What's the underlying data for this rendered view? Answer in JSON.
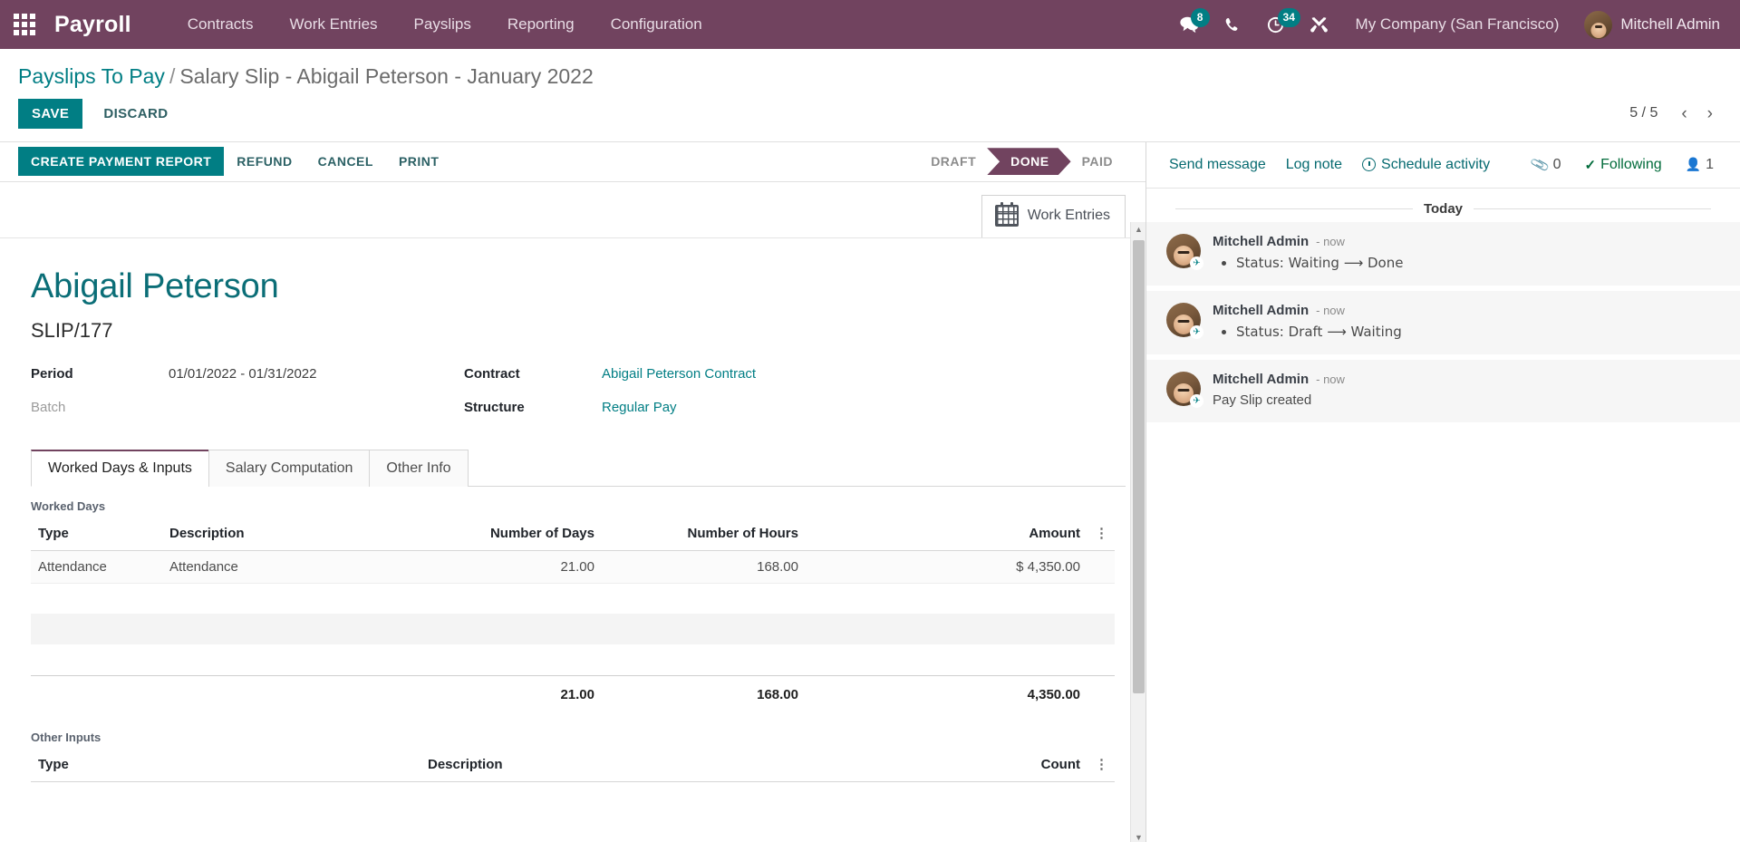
{
  "navbar": {
    "apps_icon": "apps-grid-icon",
    "brand": "Payroll",
    "menus": [
      "Contracts",
      "Work Entries",
      "Payslips",
      "Reporting",
      "Configuration"
    ],
    "messages_badge": "8",
    "activities_badge": "34",
    "company": "My Company (San Francisco)",
    "user": "Mitchell Admin",
    "icons": [
      "messages-icon",
      "phone-icon",
      "activities-icon",
      "debug-tools-icon"
    ]
  },
  "control_panel": {
    "breadcrumb_root": "Payslips To Pay",
    "breadcrumb_sep": "/",
    "breadcrumb_current": "Salary Slip - Abigail Peterson - January 2022",
    "save_label": "SAVE",
    "discard_label": "DISCARD",
    "pager_count": "5 / 5",
    "prev_glyph": "‹",
    "next_glyph": "›"
  },
  "statusbar": {
    "buttons": [
      {
        "label": "CREATE PAYMENT REPORT",
        "primary": true
      },
      {
        "label": "REFUND",
        "primary": false
      },
      {
        "label": "CANCEL",
        "primary": false
      },
      {
        "label": "PRINT",
        "primary": false
      }
    ],
    "stages": [
      {
        "label": "DRAFT",
        "active": false
      },
      {
        "label": "DONE",
        "active": true
      },
      {
        "label": "PAID",
        "active": false
      }
    ]
  },
  "form": {
    "stat_button": {
      "label": "Work Entries",
      "icon": "calendar-icon"
    },
    "title": "Abigail Peterson",
    "reference": "SLIP/177",
    "fields_left": [
      {
        "label": "Period",
        "value": "01/01/2022 - 01/31/2022",
        "muted": false,
        "link": false
      },
      {
        "label": "Batch",
        "value": "",
        "muted": true,
        "link": false
      }
    ],
    "fields_right": [
      {
        "label": "Contract",
        "value": "Abigail Peterson Contract",
        "muted": false,
        "link": true
      },
      {
        "label": "Structure",
        "value": "Regular Pay",
        "muted": false,
        "link": true
      }
    ],
    "tabs": [
      {
        "label": "Worked Days & Inputs",
        "active": true
      },
      {
        "label": "Salary Computation",
        "active": false
      },
      {
        "label": "Other Info",
        "active": false
      }
    ],
    "worked_days": {
      "section_label": "Worked Days",
      "columns": [
        "Type",
        "Description",
        "Number of Days",
        "Number of Hours",
        "Amount"
      ],
      "rows": [
        {
          "type": "Attendance",
          "description": "Attendance",
          "days": "21.00",
          "hours": "168.00",
          "amount": "$ 4,350.00"
        }
      ],
      "totals": {
        "days": "21.00",
        "hours": "168.00",
        "amount": "4,350.00"
      }
    },
    "other_inputs": {
      "section_label": "Other Inputs",
      "columns": [
        "Type",
        "Description",
        "Count"
      ]
    }
  },
  "chatter": {
    "send_message": "Send message",
    "log_note": "Log note",
    "schedule_activity": "Schedule activity",
    "attachment_count": "0",
    "following_label": "Following",
    "follower_count": "1",
    "day_separator": "Today",
    "messages": [
      {
        "author": "Mitchell Admin",
        "time": "- now",
        "bullet": true,
        "text": "Status: Waiting ⟶ Done"
      },
      {
        "author": "Mitchell Admin",
        "time": "- now",
        "bullet": true,
        "text": "Status: Draft ⟶ Waiting"
      },
      {
        "author": "Mitchell Admin",
        "time": "- now",
        "bullet": false,
        "text": "Pay Slip created"
      }
    ]
  },
  "colors": {
    "brand_purple": "#71435f",
    "accent_teal": "#017e84",
    "title_teal": "#0b6e77"
  }
}
